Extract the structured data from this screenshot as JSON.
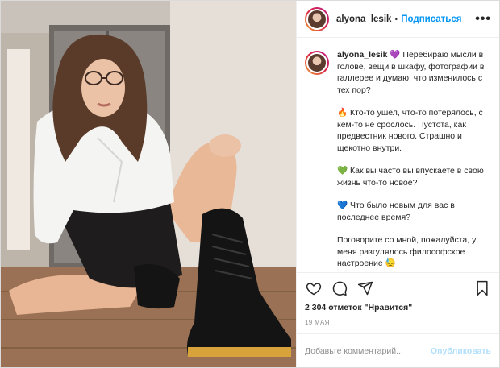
{
  "post": {
    "username": "alyona_lesik",
    "follow_label": "Подписаться",
    "dot": "•",
    "more": "•••",
    "caption": {
      "intro_emoji": "💜",
      "intro": "Перебираю мысли в голове, вещи в шкафу, фотографии в галлерее и думаю: что изменилось с тех пор?",
      "p1_emoji": "🔥",
      "p1": "Кто-то ушел, что-то потерялось, с кем-то не срослось. Пустота, как предвестник нового. Страшно и щекотно внутри.",
      "p2_emoji": "💚",
      "p2": "Как вы часто вы впускаете в свою жизнь что-то новое?",
      "p3_emoji": "💙",
      "p3": "Что было новым для вас в последнее время?",
      "p4": "Поговорите со мной, пожалуйста, у меня разгулялось философское настроение",
      "p4_emoji": "😓"
    },
    "likes": "2 304 отметок \"Нравится\"",
    "date": "19 МАЯ",
    "comment_placeholder": "Добавьте комментарий...",
    "publish_label": "Опубликовать",
    "icons": [
      "heart-icon",
      "comment-icon",
      "share-icon",
      "bookmark-icon"
    ],
    "colors": {
      "link": "#0095f6",
      "publish_disabled": "#b2dffc",
      "muted": "#8e8e8e"
    }
  }
}
